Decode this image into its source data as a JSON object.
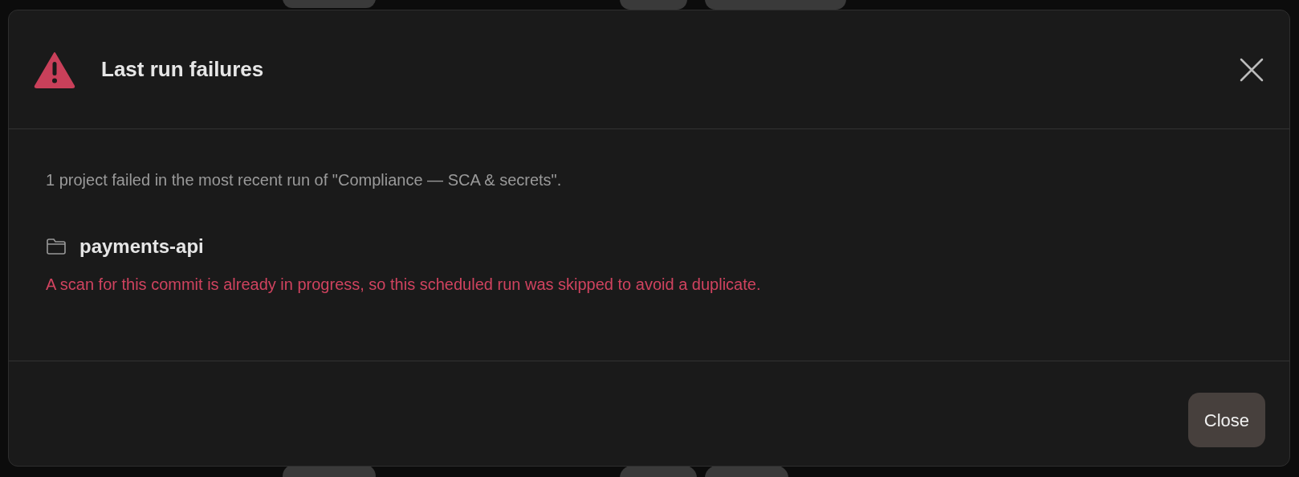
{
  "dialog": {
    "title": "Last run failures",
    "summary": "1 project failed in the most recent run of \"Compliance — SCA & secrets\".",
    "failures": [
      {
        "project": "payments-api",
        "message": "A scan for this commit is already in progress, so this scheduled run was skipped to avoid a duplicate."
      }
    ],
    "buttons": [
      "Close"
    ]
  }
}
